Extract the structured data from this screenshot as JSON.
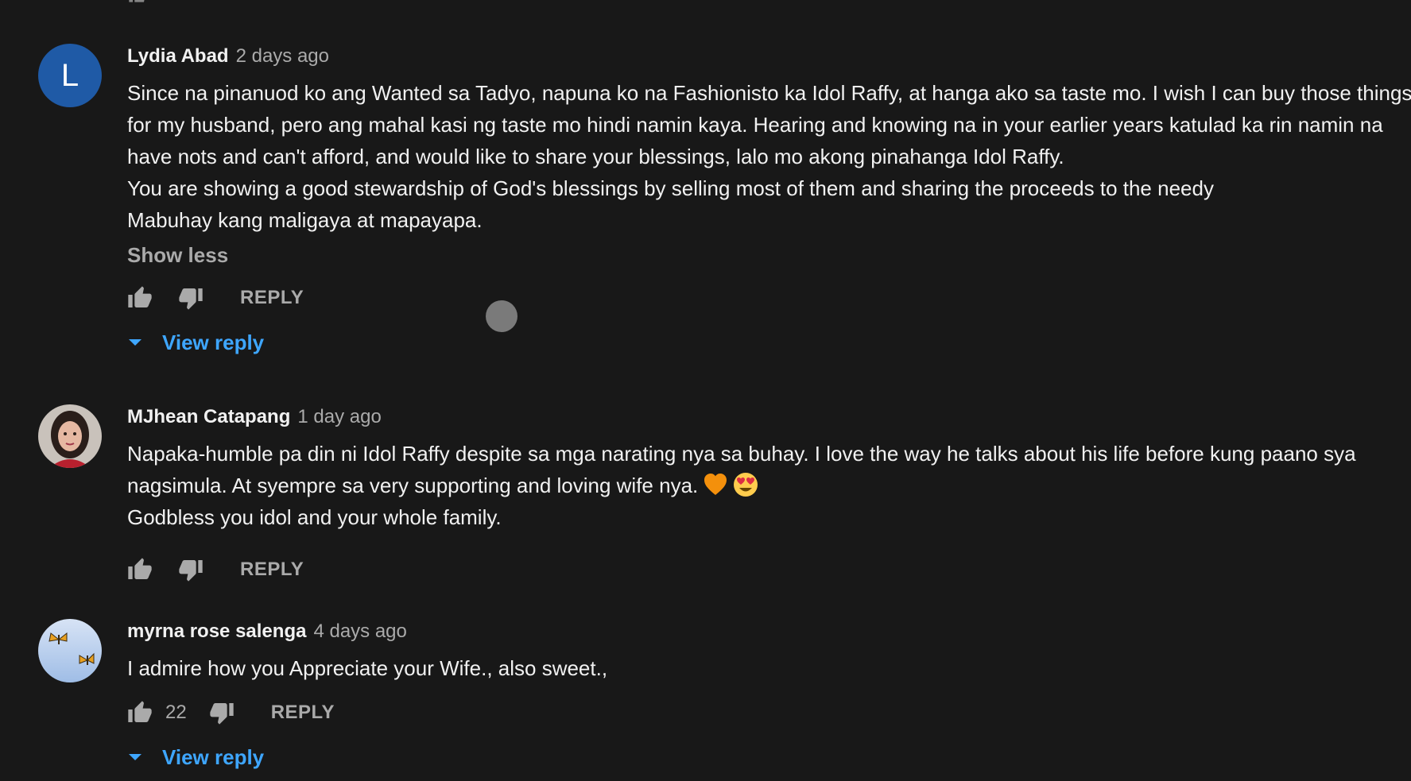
{
  "comments": [
    {
      "author": "Lydia Abad",
      "time": "2 days ago",
      "avatar_letter": "L",
      "avatar_color": "#1f5aa6",
      "text": "Since na pinanuod ko ang Wanted sa Tadyo, napuna ko na  Fashionisto  ka Idol Raffy, at hanga ako sa taste mo. I wish I can buy those things for my husband, pero ang mahal kasi ng taste mo hindi namin kaya. Hearing and knowing na in your earlier years katulad ka rin namin na have nots and can't afford, and would like to share your blessings, lalo mo akong pinahanga Idol Raffy.\nYou are showing a good stewardship of God's blessings by selling most of them and sharing the proceeds to the needy\nMabuhay kang maligaya at mapayapa.",
      "show_less": "Show less",
      "reply_label": "REPLY",
      "view_reply": "View reply"
    },
    {
      "author": "MJhean Catapang",
      "time": "1 day ago",
      "text": "Napaka-humble pa din ni Idol Raffy despite sa mga narating nya sa buhay. I love the way he talks about his life before  kung paano sya nagsimula. At syempre sa very supporting and loving wife nya.",
      "text_line2": "Godbless you idol and your whole family.",
      "emojis": [
        "orange-heart-icon",
        "heart-eyes-emoji-icon"
      ],
      "reply_label": "REPLY"
    },
    {
      "author": "myrna rose salenga",
      "time": "4 days ago",
      "text": "I admire how you Appreciate your Wife., also sweet.,",
      "like_count": "22",
      "reply_label": "REPLY",
      "view_reply": "View reply"
    }
  ],
  "colors": {
    "background": "#181818",
    "text": "#f1f1f1",
    "secondary": "#aaaaaa",
    "link": "#3ea6ff"
  }
}
